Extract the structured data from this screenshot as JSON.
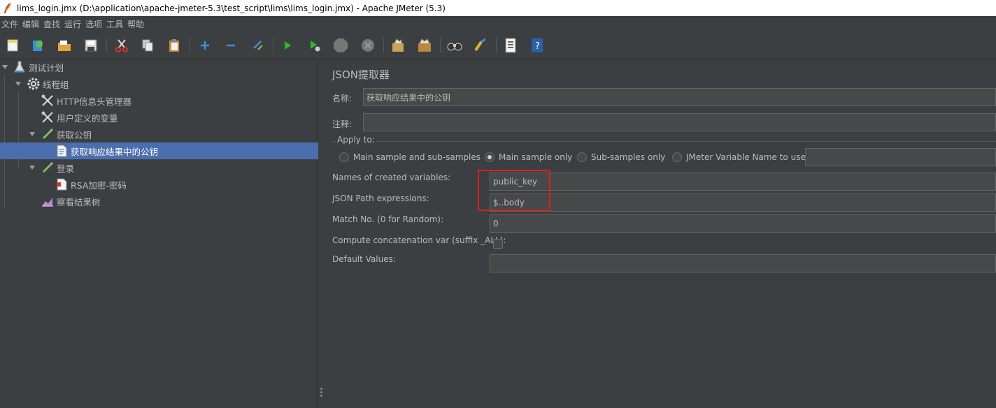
{
  "window": {
    "title": "lims_login.jmx (D:\\application\\apache-jmeter-5.3\\test_script\\lims\\lims_login.jmx) - Apache JMeter (5.3)"
  },
  "menu": [
    "文件",
    "编辑",
    "查找",
    "运行",
    "选项",
    "工具",
    "帮助"
  ],
  "toolbar": {
    "icons": [
      "new-icon",
      "templates-icon",
      "open-icon",
      "save-icon",
      "cut-icon",
      "copy-icon",
      "paste-icon",
      "expand-icon",
      "collapse-icon",
      "toggle-icon",
      "start-icon",
      "start-no-pause-icon",
      "stop-icon",
      "shutdown-icon",
      "clear-icon",
      "clear-all-icon",
      "search-icon",
      "reset-search-icon",
      "function-helper-icon",
      "help-icon"
    ]
  },
  "tree": {
    "items": [
      {
        "label": "测试计划"
      },
      {
        "label": "线程组"
      },
      {
        "label": "HTTP信息头管理器"
      },
      {
        "label": "用户定义的变量"
      },
      {
        "label": "获取公钥"
      },
      {
        "label": "获取响应结果中的公钥"
      },
      {
        "label": "登录"
      },
      {
        "label": "RSA加密-密码"
      },
      {
        "label": "察看结果树"
      }
    ]
  },
  "panel": {
    "title": "JSON提取器",
    "name_label": "名称:",
    "name_value": "获取响应结果中的公钥",
    "comment_label": "注释:",
    "comment_value": "",
    "apply_to": {
      "label": "Apply to:",
      "options": [
        "Main sample and sub-samples",
        "Main sample only",
        "Sub-samples only",
        "JMeter Variable Name to use"
      ],
      "selected": "Main sample only",
      "variable_value": ""
    },
    "vars_label": "Names of created variables:",
    "vars_value": "public_key",
    "json_path_label": "JSON Path expressions:",
    "json_path_value": "$..body",
    "match_no_label": "Match No. (0 for Random):",
    "match_no_value": "0",
    "concat_label": "Compute concatenation var (suffix _ALL):",
    "concat_checked": false,
    "default_label": "Default Values:",
    "default_value": ""
  },
  "colors": {
    "background": "#3c3f41",
    "selection": "#4b6eaf",
    "highlight_box": "#e01e1e"
  }
}
